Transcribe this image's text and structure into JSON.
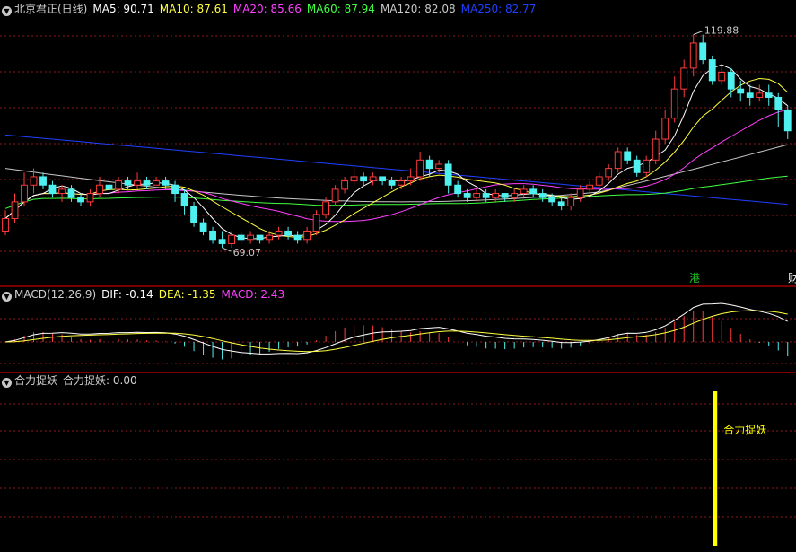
{
  "colors": {
    "background": "#000000",
    "candle_up": "#ff3b3b",
    "candle_down": "#4ff0f0",
    "grid": "#8a1a1a",
    "panel_border": "#c00000",
    "ma5": "#ffffff",
    "ma10": "#ffff40",
    "ma20": "#ff40ff",
    "ma60": "#40ff40",
    "ma120": "#c8c8c8",
    "ma250": "#2040ff",
    "signal": "#ffff00",
    "label_text": "#d0d0d0"
  },
  "panels": {
    "price": {
      "icon": "chevron-down-icon",
      "title": "北京君正(日线)",
      "ma_items": [
        {
          "label": "MA5: 90.71",
          "color": "#ffffff"
        },
        {
          "label": "MA10: 87.61",
          "color": "#ffff40"
        },
        {
          "label": "MA20: 85.66",
          "color": "#ff40ff"
        },
        {
          "label": "MA60: 87.94",
          "color": "#40ff40"
        },
        {
          "label": "MA120: 82.08",
          "color": "#c8c8c8"
        },
        {
          "label": "MA250: 82.77",
          "color": "#2040ff"
        }
      ],
      "high_label": "119.88",
      "low_label": "69.07",
      "badges": [
        {
          "text": "港",
          "color": "#20c020"
        },
        {
          "text": "财",
          "color": "#ffffff"
        }
      ]
    },
    "macd": {
      "icon": "chevron-down-icon",
      "title": "MACD(12,26,9)",
      "items": [
        {
          "label": "DIF: -0.14",
          "color": "#ffffff"
        },
        {
          "label": "DEA: -1.35",
          "color": "#ffff40"
        },
        {
          "label": "MACD: 2.43",
          "color": "#ff40ff"
        }
      ]
    },
    "signal": {
      "icon": "chevron-down-icon",
      "title": "合力捉妖",
      "value_label": "合力捉妖: 0.00",
      "marker_text": "合力捉妖"
    }
  },
  "chart_data": [
    {
      "type": "candlestick",
      "title": "北京君正(日线)",
      "ylim": [
        60,
        124
      ],
      "high": 119.88,
      "low": 69.07,
      "candles": [
        [
          73,
          76,
          72,
          78
        ],
        [
          76,
          80,
          75,
          82
        ],
        [
          80,
          84,
          79,
          87
        ],
        [
          84,
          86,
          82,
          88
        ],
        [
          86,
          84,
          83,
          87
        ],
        [
          84,
          82,
          81,
          85
        ],
        [
          82,
          83,
          80,
          84
        ],
        [
          83,
          81,
          80,
          84
        ],
        [
          81,
          80,
          79,
          82
        ],
        [
          80,
          82,
          79,
          83
        ],
        [
          82,
          84,
          81,
          86
        ],
        [
          84,
          83,
          82,
          85
        ],
        [
          83,
          85,
          82,
          86
        ],
        [
          85,
          84,
          83,
          86
        ],
        [
          84,
          85,
          83,
          87
        ],
        [
          85,
          84,
          83,
          86
        ],
        [
          84,
          85,
          84,
          86
        ],
        [
          85,
          84,
          83,
          86
        ],
        [
          84,
          82,
          80,
          85
        ],
        [
          82,
          79,
          77,
          83
        ],
        [
          79,
          75,
          74,
          80
        ],
        [
          75,
          73,
          72,
          76
        ],
        [
          73,
          71,
          70,
          74
        ],
        [
          71,
          70,
          69,
          73
        ],
        [
          70,
          72,
          69,
          73
        ],
        [
          72,
          71,
          70,
          73
        ],
        [
          71,
          72,
          70,
          73
        ],
        [
          72,
          71,
          70,
          72
        ],
        [
          71,
          72,
          70,
          73
        ],
        [
          72,
          73,
          71,
          74
        ],
        [
          73,
          72,
          71,
          74
        ],
        [
          72,
          71,
          70,
          73
        ],
        [
          71,
          73,
          70,
          74
        ],
        [
          73,
          77,
          72,
          78
        ],
        [
          77,
          80,
          76,
          81
        ],
        [
          80,
          83,
          79,
          84
        ],
        [
          83,
          85,
          82,
          86
        ],
        [
          85,
          86,
          84,
          88
        ],
        [
          86,
          85,
          84,
          87
        ],
        [
          85,
          86,
          84,
          87
        ],
        [
          86,
          85,
          84,
          86
        ],
        [
          85,
          84,
          83,
          86
        ],
        [
          84,
          85,
          83,
          86
        ],
        [
          85,
          86,
          84,
          88
        ],
        [
          86,
          90,
          85,
          92
        ],
        [
          90,
          88,
          86,
          91
        ],
        [
          88,
          89,
          87,
          90
        ],
        [
          89,
          84,
          82,
          90
        ],
        [
          84,
          82,
          81,
          85
        ],
        [
          82,
          81,
          80,
          83
        ],
        [
          81,
          82,
          80,
          83
        ],
        [
          82,
          81,
          80,
          83
        ],
        [
          81,
          82,
          80,
          83
        ],
        [
          82,
          81,
          80,
          82
        ],
        [
          81,
          82,
          80,
          83
        ],
        [
          82,
          83,
          81,
          84
        ],
        [
          83,
          82,
          81,
          84
        ],
        [
          82,
          81,
          80,
          83
        ],
        [
          81,
          80,
          79,
          82
        ],
        [
          80,
          79,
          78,
          81
        ],
        [
          79,
          81,
          78,
          82
        ],
        [
          81,
          83,
          80,
          84
        ],
        [
          83,
          84,
          82,
          85
        ],
        [
          84,
          86,
          83,
          87
        ],
        [
          86,
          88,
          85,
          89
        ],
        [
          88,
          92,
          87,
          93
        ],
        [
          92,
          90,
          89,
          93
        ],
        [
          90,
          87,
          86,
          91
        ],
        [
          87,
          90,
          86,
          91
        ],
        [
          90,
          95,
          89,
          97
        ],
        [
          95,
          100,
          94,
          102
        ],
        [
          100,
          107,
          99,
          110
        ],
        [
          107,
          112,
          105,
          114
        ],
        [
          112,
          118,
          110,
          120
        ],
        [
          118,
          114,
          113,
          120
        ],
        [
          114,
          109,
          108,
          115
        ],
        [
          109,
          111,
          108,
          113
        ],
        [
          111,
          107,
          105,
          112
        ],
        [
          107,
          106,
          104,
          109
        ],
        [
          106,
          105,
          103,
          108
        ],
        [
          105,
          106,
          104,
          108
        ],
        [
          106,
          105,
          103,
          108
        ],
        [
          105,
          102,
          98,
          106
        ],
        [
          102,
          97,
          95,
          103
        ]
      ],
      "ma": {
        "MA5": 90.71,
        "MA10": 87.61,
        "MA20": 85.66,
        "MA60": 87.94,
        "MA120": 82.08,
        "MA250": 82.77
      }
    },
    {
      "type": "bar",
      "title": "MACD(12,26,9)",
      "series": [
        {
          "name": "DIF",
          "value": -0.14
        },
        {
          "name": "DEA",
          "value": -1.35
        },
        {
          "name": "MACD",
          "value": 2.43
        }
      ]
    },
    {
      "type": "bar",
      "title": "合力捉妖",
      "value": 0.0,
      "signal_index": 76
    }
  ]
}
